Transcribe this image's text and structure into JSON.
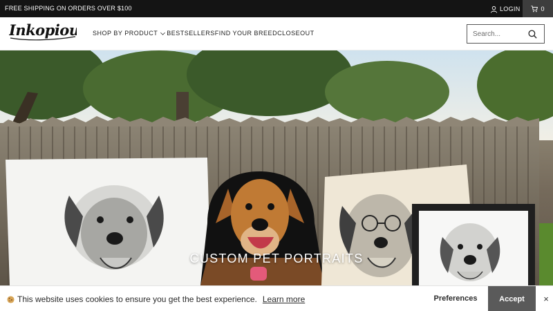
{
  "announcement": "FREE SHIPPING ON ORDERS OVER $100",
  "account": {
    "login_label": "LOGIN",
    "cart_count": "0"
  },
  "brand": {
    "logo_text": "Inkopious"
  },
  "nav": [
    {
      "label": "SHOP BY PRODUCT",
      "has_dropdown": true
    },
    {
      "label": "BESTSELLERS",
      "has_dropdown": false
    },
    {
      "label": "FIND YOUR BREED",
      "has_dropdown": false
    },
    {
      "label": "CLOSEOUT",
      "has_dropdown": false
    }
  ],
  "search": {
    "placeholder": "Search..."
  },
  "hero": {
    "title": "CUSTOM PET PORTRAITS"
  },
  "cookie": {
    "message": "This website uses cookies to ensure you get the best experience.",
    "learn_more": "Learn more",
    "preferences": "Preferences",
    "accept": "Accept",
    "close": "×"
  },
  "icons": [
    "user-icon",
    "cart-icon",
    "chevron-down-icon",
    "search-icon",
    "cookie-icon",
    "close-icon"
  ],
  "colors": {
    "topbar": "#141414",
    "cart_bg": "#3d3d3d",
    "accept_bg": "#5a5a5a",
    "text": "#1c1c1c"
  }
}
